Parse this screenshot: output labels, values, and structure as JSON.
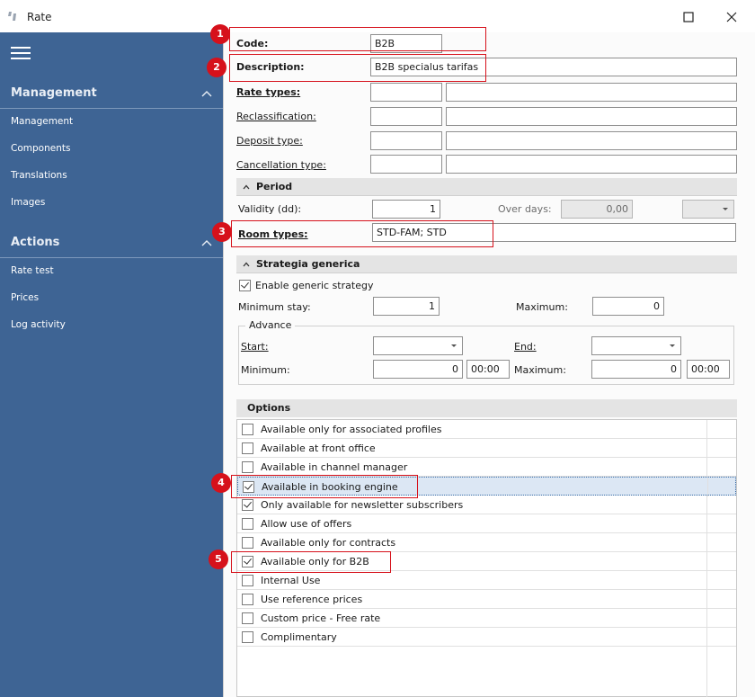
{
  "window": {
    "title": "Rate",
    "maximize_icon": "maximize-icon",
    "close_icon": "close-icon"
  },
  "sidebar": {
    "menu_icon": "hamburger-icon",
    "sections": [
      {
        "title": "Management",
        "items": [
          "Management",
          "Components",
          "Translations",
          "Images"
        ]
      },
      {
        "title": "Actions",
        "items": [
          "Rate test",
          "Prices",
          "Log activity"
        ]
      }
    ]
  },
  "form": {
    "code": {
      "label": "Code:",
      "value": "B2B"
    },
    "description": {
      "label": "Description:",
      "value": "B2B specialus tarifas"
    },
    "rate_types": {
      "label": "Rate types:",
      "code": "",
      "desc": ""
    },
    "reclassification": {
      "label": "Reclassification:",
      "code": "",
      "desc": ""
    },
    "deposit_type": {
      "label": "Deposit type:",
      "code": "",
      "desc": ""
    },
    "cancellation_type": {
      "label": "Cancellation type:",
      "code": "",
      "desc": ""
    }
  },
  "period": {
    "title": "Period",
    "validity_label": "Validity (dd):",
    "validity_value": "1",
    "over_days_label": "Over days:",
    "over_days_value": "0,00",
    "over_days_combo": "",
    "room_types_label": "Room types:",
    "room_types_value": "STD-FAM; STD"
  },
  "strategy": {
    "title": "Strategia generica",
    "enable_label": "Enable generic strategy",
    "enable_checked": true,
    "min_stay_label": "Minimum stay:",
    "min_stay_value": "1",
    "maximum_label": "Maximum:",
    "maximum_value": "0",
    "advance": {
      "title": "Advance",
      "start_label": "Start:",
      "start_value": "",
      "end_label": "End:",
      "end_value": "",
      "minimum_label": "Minimum:",
      "minimum_value": "0",
      "minimum_time": "00:00",
      "maximum_label": "Maximum:",
      "maximum_value": "0",
      "maximum_time": "00:00"
    }
  },
  "options": {
    "title": "Options",
    "items": [
      {
        "label": "Available only for associated profiles",
        "checked": false
      },
      {
        "label": "Available at front office",
        "checked": false
      },
      {
        "label": "Available in channel manager",
        "checked": false
      },
      {
        "label": "Available in booking engine",
        "checked": true
      },
      {
        "label": "Only available for newsletter subscribers",
        "checked": true
      },
      {
        "label": "Allow use of offers",
        "checked": false
      },
      {
        "label": "Available only for contracts",
        "checked": false
      },
      {
        "label": "Available only for B2B",
        "checked": true
      },
      {
        "label": "Internal Use",
        "checked": false
      },
      {
        "label": "Use reference prices",
        "checked": false
      },
      {
        "label": "Custom price - Free rate",
        "checked": false
      },
      {
        "label": "Complimentary",
        "checked": false
      }
    ],
    "selected_index": 3
  },
  "annotations": [
    "1",
    "2",
    "3",
    "4",
    "5"
  ],
  "colors": {
    "sidebar_bg": "#3e6494",
    "annotation_red": "#d6111b",
    "selection_bg": "#dce7f4"
  }
}
